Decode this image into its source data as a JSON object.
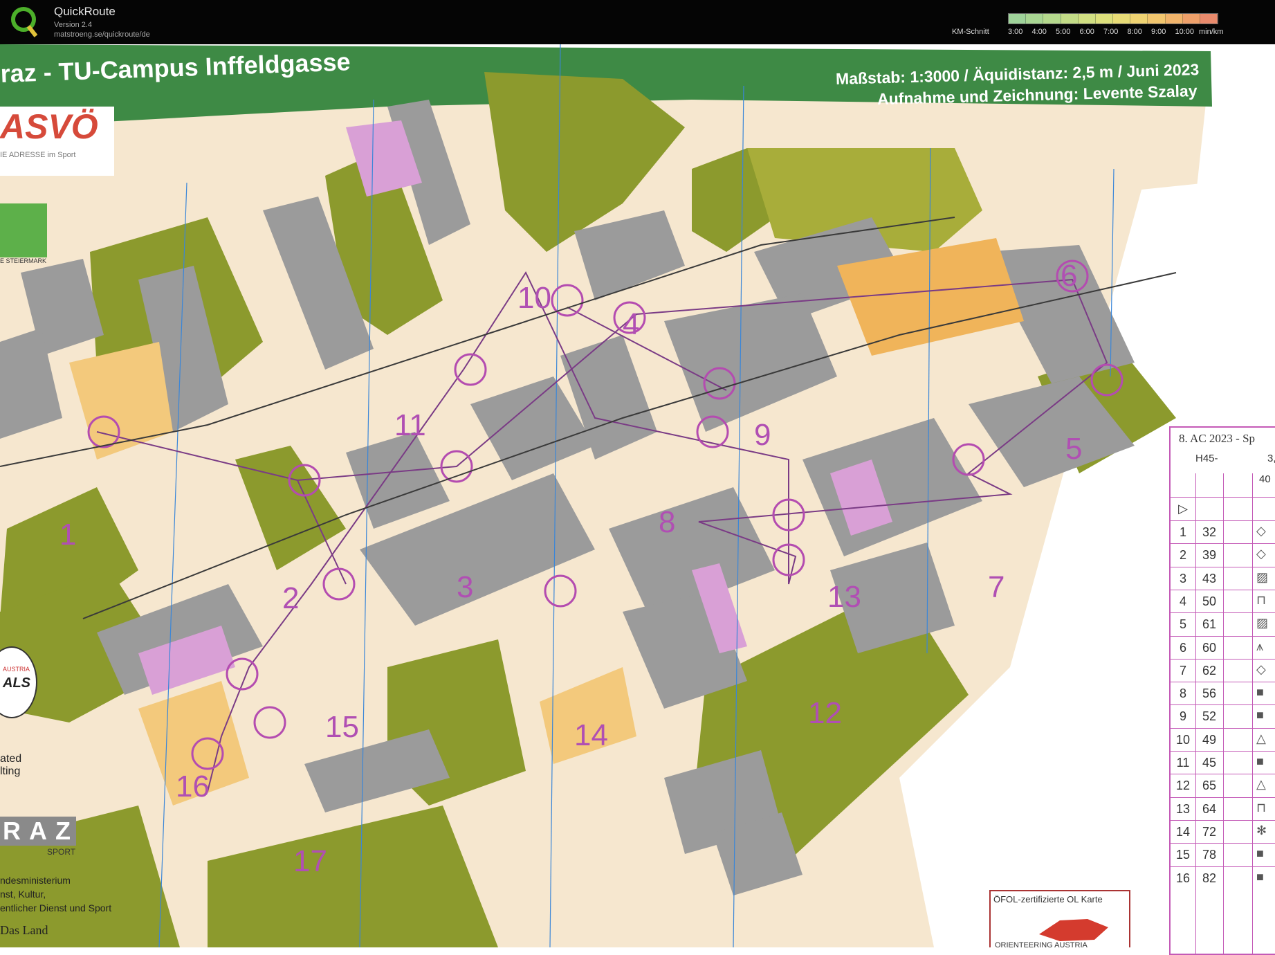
{
  "app": {
    "name": "QuickRoute",
    "version": "Version 2.4",
    "url": "matstroeng.se/quickroute/de",
    "km_label": "KM-Schnitt",
    "pace_ticks": [
      "3:00",
      "4:00",
      "5:00",
      "6:00",
      "7:00",
      "8:00",
      "9:00",
      "10:00",
      "min/km"
    ],
    "pace_colors": [
      "#9fd39a",
      "#a9d693",
      "#b5d98d",
      "#c3dc87",
      "#d1df82",
      "#dde07c",
      "#e8dc77",
      "#efd372",
      "#f2c66e",
      "#f1b46b",
      "#eea06a",
      "#e98a6c"
    ]
  },
  "map": {
    "title": "raz - TU-Campus Inffeldgasse",
    "scale_line": "Maßstab: 1:3000 / Äquidistanz: 2,5 m / Juni 2023",
    "author_line": "Aufnahme und Zeichnung: Levente Szalay",
    "sponsor_asvo": "ASVÖ",
    "sponsor_asvo_sub": "IE ADRESSE im Sport",
    "sponsor_stmk": "E STEIERMARK",
    "sponsor_austria": "AUSTRIA",
    "sponsor_als": "ALS",
    "side_text_1": "ated",
    "side_text_2": "lting",
    "sponsor_graz": "RAZ",
    "sponsor_graz_sub": "SPORT",
    "ministry_1": "ndesministerium",
    "ministry_2": "nst, Kultur,",
    "ministry_3": "entlicher Dienst und Sport",
    "ministry_4": "Das Land",
    "cert_label": "ÖFOL-zertifizierte OL Karte",
    "cert_sub": "ORIENTEERING AUSTRIA",
    "controls": [
      "1",
      "2",
      "3",
      "4",
      "5",
      "6",
      "7",
      "8",
      "9",
      "10",
      "11",
      "12",
      "13",
      "14",
      "15",
      "16",
      "17"
    ]
  },
  "description_sheet": {
    "title": "8. AC 2023 - Sp",
    "class": "H45-",
    "length": "3,",
    "climb": "40",
    "rows": [
      {
        "n": "1",
        "code": "32",
        "sym": "◇"
      },
      {
        "n": "2",
        "code": "39",
        "sym": "◇"
      },
      {
        "n": "3",
        "code": "43",
        "sym": "▨"
      },
      {
        "n": "4",
        "code": "50",
        "sym": "⊓"
      },
      {
        "n": "5",
        "code": "61",
        "sym": "▨"
      },
      {
        "n": "6",
        "code": "60",
        "sym": "⩚"
      },
      {
        "n": "7",
        "code": "62",
        "sym": "◇"
      },
      {
        "n": "8",
        "code": "56",
        "sym": "■"
      },
      {
        "n": "9",
        "code": "52",
        "sym": "■"
      },
      {
        "n": "10",
        "code": "49",
        "sym": "△"
      },
      {
        "n": "11",
        "code": "45",
        "sym": "■"
      },
      {
        "n": "12",
        "code": "65",
        "sym": "△"
      },
      {
        "n": "13",
        "code": "64",
        "sym": "⊓"
      },
      {
        "n": "14",
        "code": "72",
        "sym": "✻"
      },
      {
        "n": "15",
        "code": "78",
        "sym": "■"
      },
      {
        "n": "16",
        "code": "82",
        "sym": "■"
      }
    ]
  }
}
